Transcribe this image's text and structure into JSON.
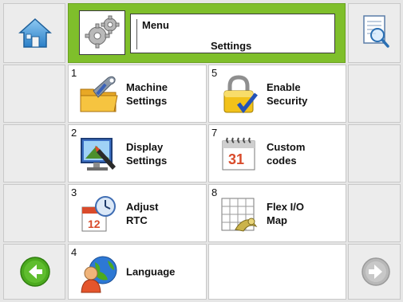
{
  "header": {
    "title": "Menu",
    "subtitle": "Settings"
  },
  "nav": {
    "home_icon": "home-icon",
    "preview_icon": "document-search-icon",
    "back_icon": "arrow-left-icon",
    "forward_icon": "arrow-right-icon"
  },
  "menu": {
    "items": [
      {
        "number": "1",
        "label": "Machine\nSettings",
        "icon": "wrench-folder-icon"
      },
      {
        "number": "2",
        "label": "Display\nSettings",
        "icon": "monitor-icon"
      },
      {
        "number": "3",
        "label": "Adjust\nRTC",
        "icon": "calendar-clock-icon"
      },
      {
        "number": "4",
        "label": "Language",
        "icon": "globe-person-icon"
      },
      {
        "number": "5",
        "label": "Enable\nSecurity",
        "icon": "padlock-icon"
      },
      {
        "number": "7",
        "label": "Custom\ncodes",
        "icon": "calendar-31-icon"
      },
      {
        "number": "8",
        "label": "Flex I/O\nMap",
        "icon": "grid-map-icon"
      }
    ]
  },
  "colors": {
    "header_green": "#7fbf2b",
    "nav_button_green": "#4caa1f",
    "disabled_grey": "#b8b8b8"
  }
}
